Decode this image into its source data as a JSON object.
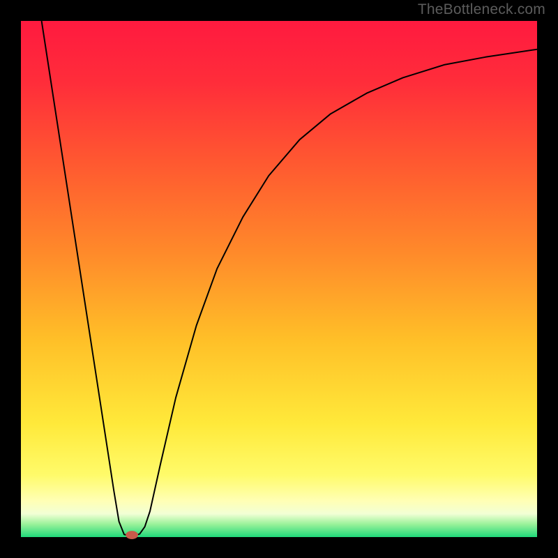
{
  "watermark": "TheBottleneck.com",
  "chart_data": {
    "type": "line",
    "title": "",
    "xlabel": "",
    "ylabel": "",
    "xlim": [
      0,
      100
    ],
    "ylim": [
      0,
      100
    ],
    "background_gradient": {
      "stops": [
        {
          "offset": 0.0,
          "color": "#ff1a3f"
        },
        {
          "offset": 0.12,
          "color": "#ff2d3a"
        },
        {
          "offset": 0.28,
          "color": "#ff5a30"
        },
        {
          "offset": 0.45,
          "color": "#ff8a2a"
        },
        {
          "offset": 0.62,
          "color": "#ffc028"
        },
        {
          "offset": 0.78,
          "color": "#ffe93a"
        },
        {
          "offset": 0.88,
          "color": "#fffb6a"
        },
        {
          "offset": 0.93,
          "color": "#ffffb5"
        },
        {
          "offset": 0.955,
          "color": "#f2ffd5"
        },
        {
          "offset": 0.975,
          "color": "#9af29a"
        },
        {
          "offset": 1.0,
          "color": "#1fd97a"
        }
      ]
    },
    "border_color": "#000000",
    "border_width_px": 30,
    "series": [
      {
        "name": "bottleneck-curve",
        "type": "line",
        "color": "#000000",
        "stroke_width": 2,
        "points": [
          {
            "x": 4.0,
            "y": 100.0
          },
          {
            "x": 6.0,
            "y": 87.0
          },
          {
            "x": 8.0,
            "y": 74.0
          },
          {
            "x": 10.0,
            "y": 61.0
          },
          {
            "x": 12.0,
            "y": 48.0
          },
          {
            "x": 14.0,
            "y": 35.0
          },
          {
            "x": 16.0,
            "y": 22.0
          },
          {
            "x": 18.0,
            "y": 9.0
          },
          {
            "x": 19.0,
            "y": 3.0
          },
          {
            "x": 20.0,
            "y": 0.5
          },
          {
            "x": 21.0,
            "y": 0.3
          },
          {
            "x": 22.0,
            "y": 0.3
          },
          {
            "x": 23.0,
            "y": 0.6
          },
          {
            "x": 24.0,
            "y": 2.0
          },
          {
            "x": 25.0,
            "y": 5.0
          },
          {
            "x": 27.0,
            "y": 14.0
          },
          {
            "x": 30.0,
            "y": 27.0
          },
          {
            "x": 34.0,
            "y": 41.0
          },
          {
            "x": 38.0,
            "y": 52.0
          },
          {
            "x": 43.0,
            "y": 62.0
          },
          {
            "x": 48.0,
            "y": 70.0
          },
          {
            "x": 54.0,
            "y": 77.0
          },
          {
            "x": 60.0,
            "y": 82.0
          },
          {
            "x": 67.0,
            "y": 86.0
          },
          {
            "x": 74.0,
            "y": 89.0
          },
          {
            "x": 82.0,
            "y": 91.5
          },
          {
            "x": 90.0,
            "y": 93.0
          },
          {
            "x": 100.0,
            "y": 94.5
          }
        ]
      }
    ],
    "marker": {
      "name": "optimum-marker",
      "x": 21.5,
      "y": 0.4,
      "rx": 1.2,
      "ry": 0.8,
      "color": "#c95a4a"
    }
  }
}
